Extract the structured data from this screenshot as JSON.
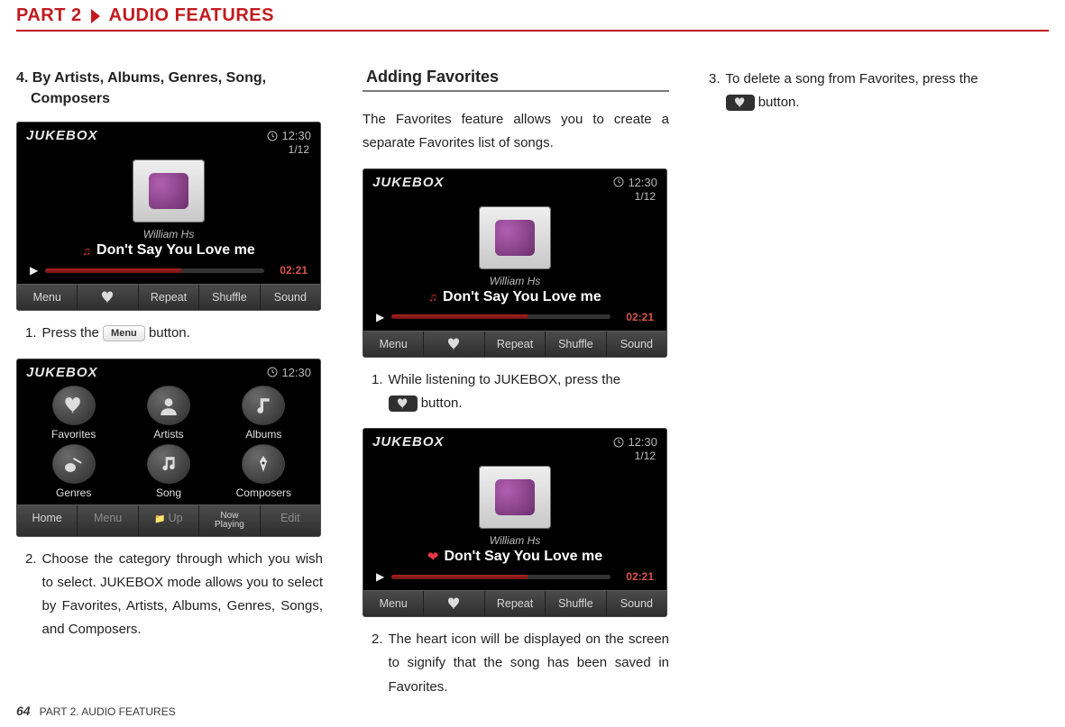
{
  "header": {
    "part": "PART 2",
    "title": "AUDIO FEATURES"
  },
  "col1": {
    "heading_line1": "4. By Artists, Albums, Genres, Song,",
    "heading_line2": "Composers",
    "step1_num": "1.",
    "step1_a": "Press the ",
    "step1_btn": "Menu",
    "step1_b": " button.",
    "step2_num": "2.",
    "step2": "Choose the category through which you wish to select. JUKEBOX mode allows you to select by Favorites, Artists, Albums, Genres, Songs, and Composers."
  },
  "col2": {
    "heading": "Adding Favorites",
    "intro": "The Favorites feature allows you to create a separate Favorites list of songs.",
    "step1_num": "1.",
    "step1_a": "While listening to JUKEBOX, press the",
    "step1_b": "button.",
    "step2_num": "2.",
    "step2": "The heart icon will be displayed on the screen to signify that the song has been saved in Favorites."
  },
  "col3": {
    "step3_num": "3.",
    "step3_a": "To delete a song from Favorites, press the",
    "step3_b": "button."
  },
  "jb_common": {
    "title": "JUKEBOX",
    "clock": "12:30",
    "count": "1/12",
    "artist": "William Hs",
    "song": "Don't Say You Love me",
    "time": "02:21",
    "b_menu": "Menu",
    "b_repeat": "Repeat",
    "b_shuffle": "Shuffle",
    "b_sound": "Sound",
    "b_home": "Home",
    "b_up": "Up",
    "b_now1": "Now",
    "b_now2": "Playing",
    "b_edit": "Edit"
  },
  "jb_grid": {
    "favorites": "Favorites",
    "artists": "Artists",
    "albums": "Albums",
    "genres": "Genres",
    "song": "Song",
    "composers": "Composers"
  },
  "footer": {
    "page": "64",
    "crumb": "PART 2. AUDIO FEATURES"
  }
}
